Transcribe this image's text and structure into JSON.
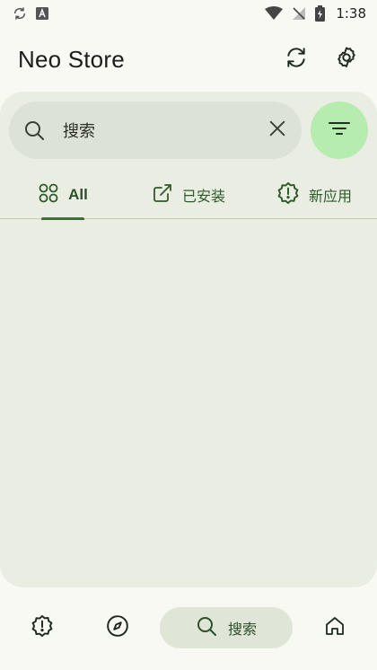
{
  "status_bar": {
    "time": "1:38",
    "icons": [
      "sync-icon",
      "font-a-icon",
      "wifi-icon",
      "signal-off-icon",
      "battery-icon"
    ]
  },
  "header": {
    "title": "Neo Store",
    "actions": [
      "sync-icon",
      "settings-gear-icon"
    ]
  },
  "search": {
    "value": "搜索",
    "icon": "search-icon",
    "clear_icon": "close-icon",
    "filter_icon": "filter-icon"
  },
  "tabs": [
    {
      "label": "All",
      "icon": "grid-icon",
      "selected": true
    },
    {
      "label": "已安装",
      "icon": "open-external-icon",
      "selected": false
    },
    {
      "label": "新应用",
      "icon": "new-badge-icon",
      "selected": false
    }
  ],
  "bottom_nav": {
    "items": [
      {
        "icon": "alert-badge-icon"
      },
      {
        "icon": "compass-icon"
      },
      {
        "icon": "search-icon",
        "label": "搜索",
        "selected": true
      },
      {
        "icon": "home-icon"
      }
    ]
  },
  "colors": {
    "accent": "#3e6f37",
    "filter_bg": "#b7ecb0",
    "panel_bg": "#e9ede2"
  }
}
